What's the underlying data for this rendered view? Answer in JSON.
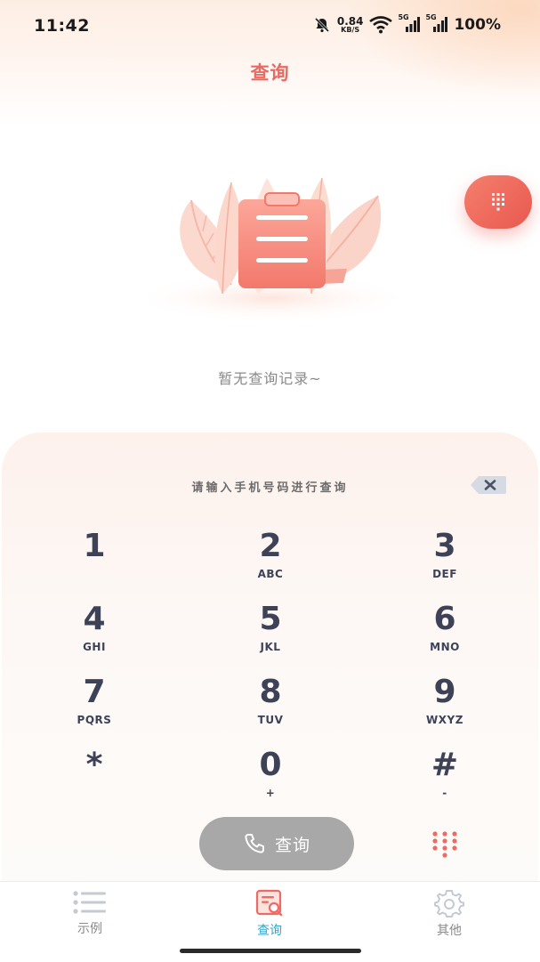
{
  "status_bar": {
    "time": "11:42",
    "net_speed_value": "0.84",
    "net_speed_unit": "KB/S",
    "signal_1_label": "5G",
    "signal_2_label": "5G",
    "battery": "100%"
  },
  "header": {
    "title": "查询"
  },
  "empty_state": {
    "text": "暂无查询记录~"
  },
  "dialpad": {
    "hint": "请输入手机号码进行查询",
    "keys": [
      {
        "num": "1",
        "letters": ""
      },
      {
        "num": "2",
        "letters": "ABC"
      },
      {
        "num": "3",
        "letters": "DEF"
      },
      {
        "num": "4",
        "letters": "GHI"
      },
      {
        "num": "5",
        "letters": "JKL"
      },
      {
        "num": "6",
        "letters": "MNO"
      },
      {
        "num": "7",
        "letters": "PQRS"
      },
      {
        "num": "8",
        "letters": "TUV"
      },
      {
        "num": "9",
        "letters": "WXYZ"
      },
      {
        "num": "*",
        "letters": ""
      },
      {
        "num": "0",
        "letters": "+"
      },
      {
        "num": "#",
        "letters": "-"
      }
    ],
    "query_button_label": "查询"
  },
  "tabbar": {
    "tabs": [
      {
        "label": "示例",
        "icon": "list-icon"
      },
      {
        "label": "查询",
        "icon": "search-document-icon",
        "active": true
      },
      {
        "label": "其他",
        "icon": "gear-icon"
      }
    ]
  },
  "colors": {
    "accent": "#e96a63",
    "tab_active": "#2fa7c9",
    "key_text": "#3d4257",
    "query_button_bg": "#a8a8a8"
  }
}
